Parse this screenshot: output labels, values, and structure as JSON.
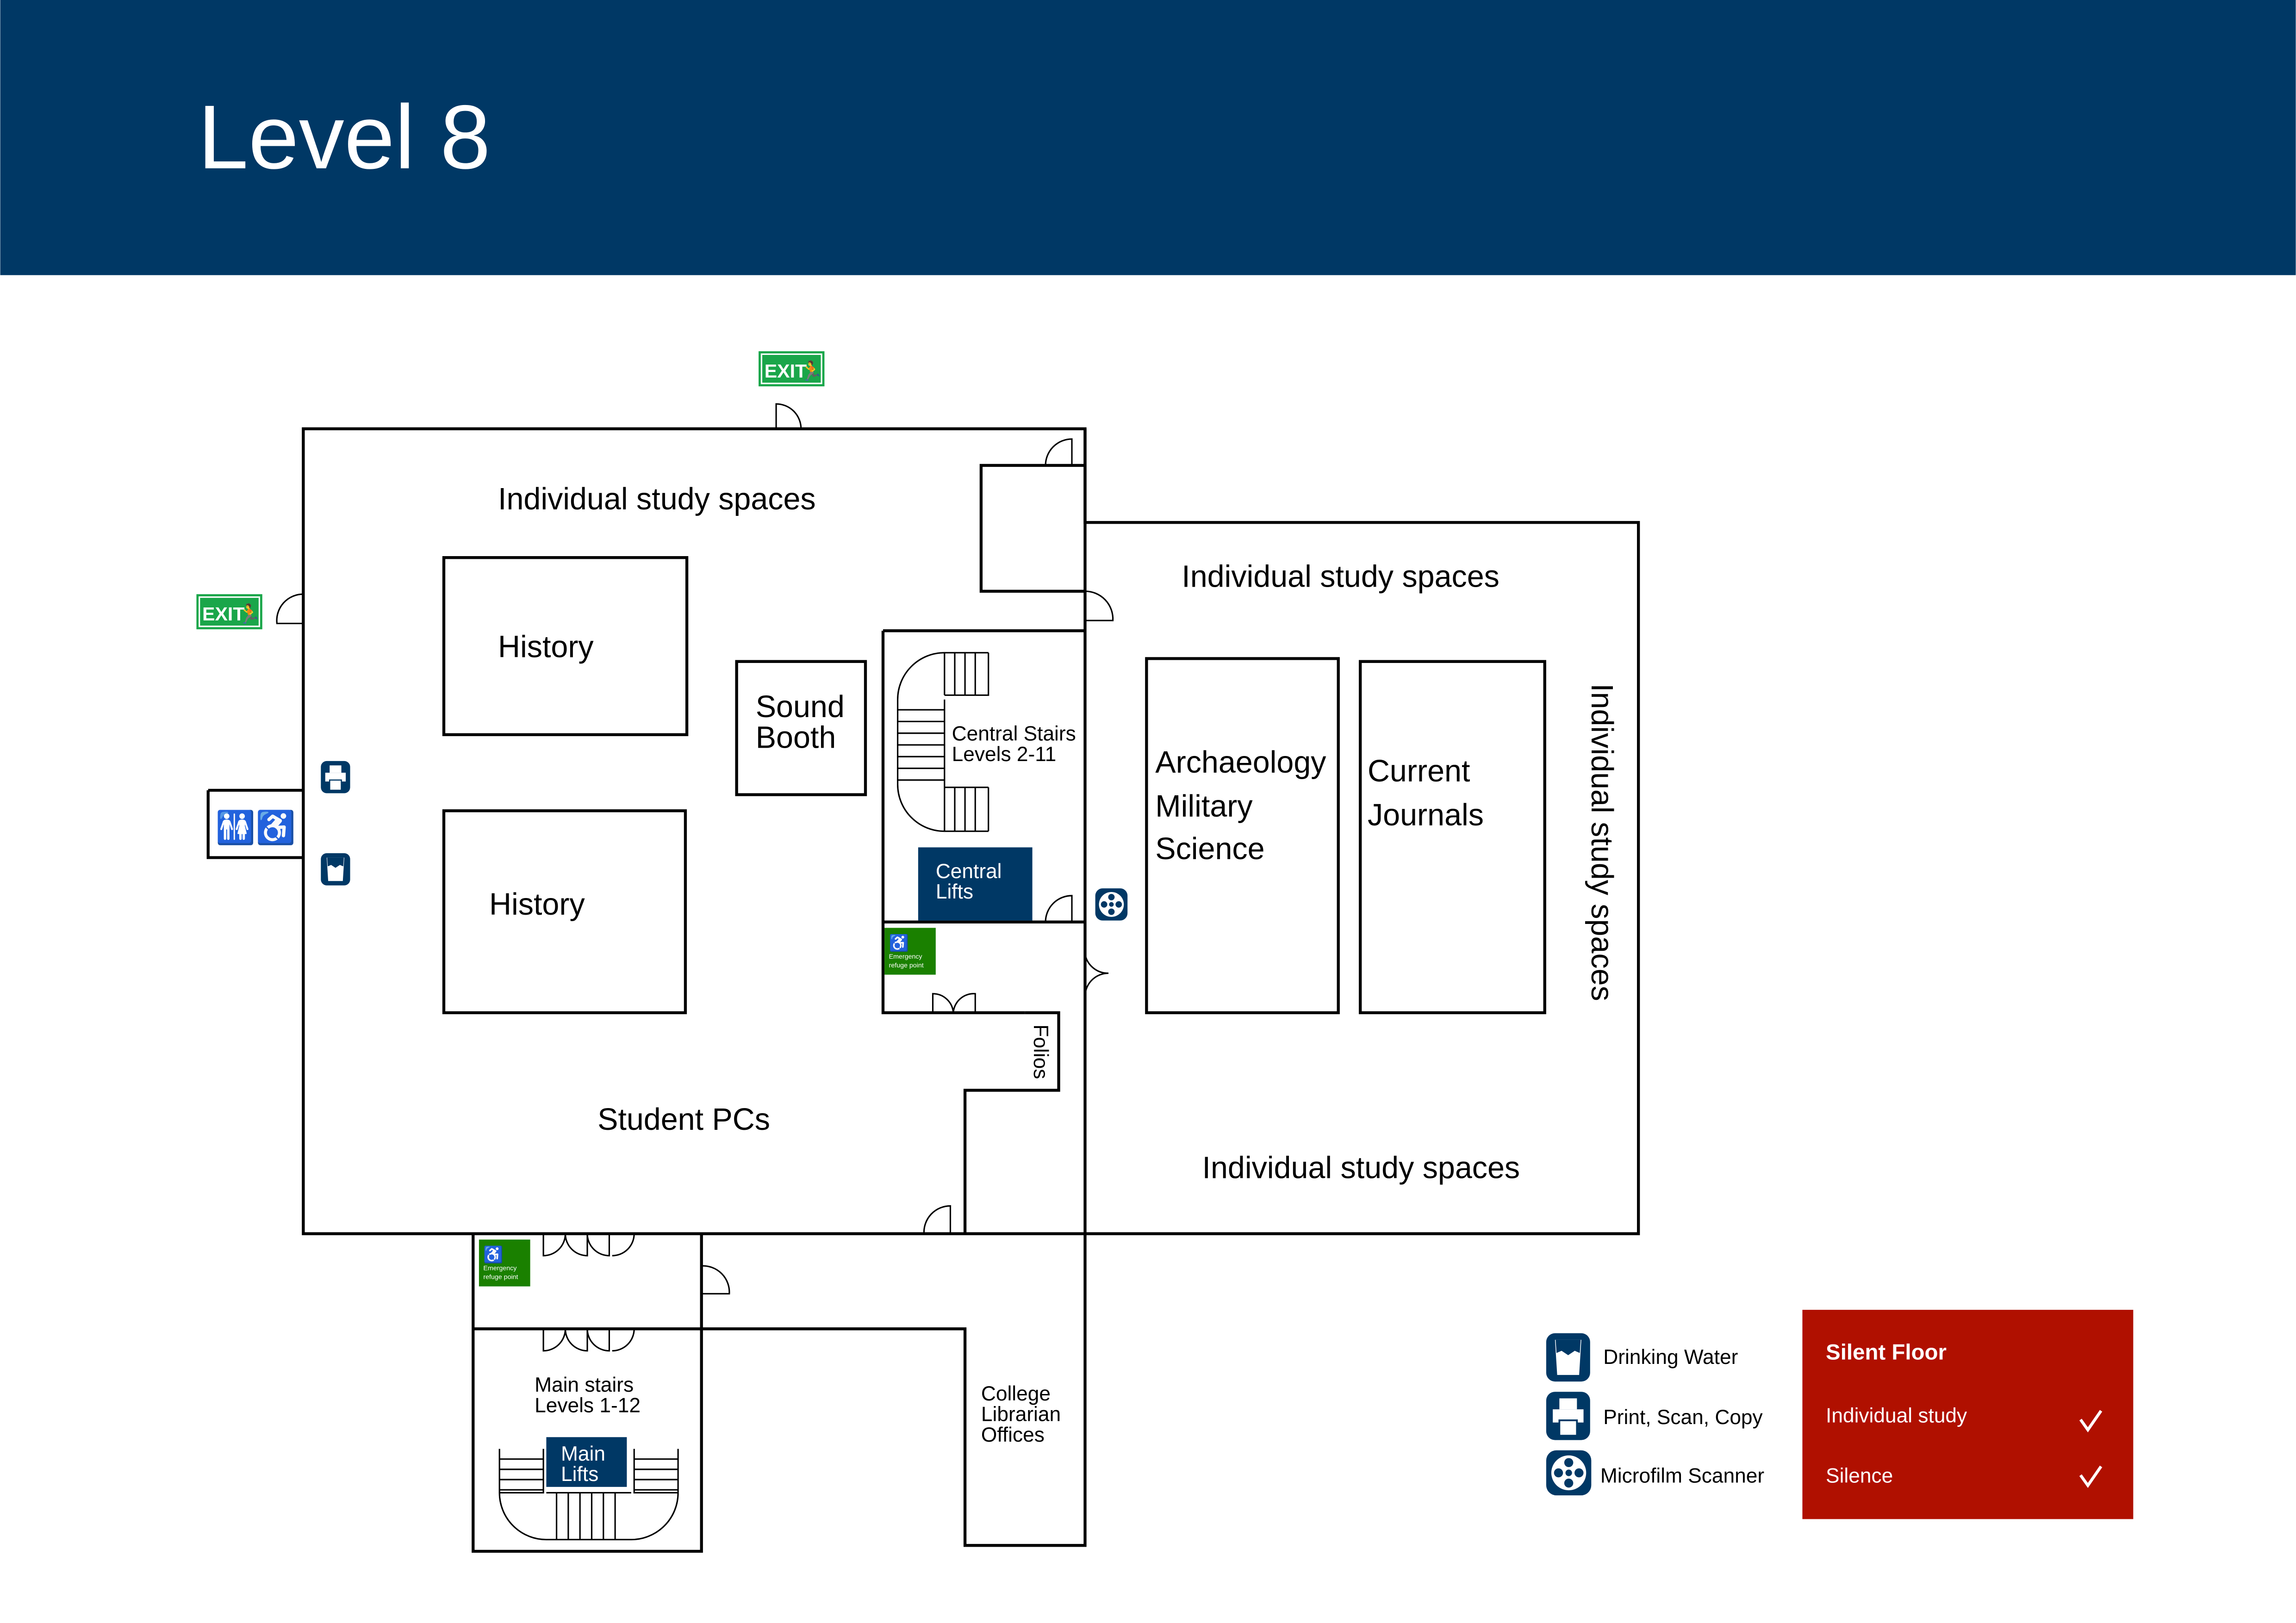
{
  "header": {
    "title": "Level 8",
    "background": "#003865"
  },
  "signs": {
    "exit": "EXIT",
    "refuge": [
      "Emergency",
      "refuge point"
    ]
  },
  "rooms": {
    "study_top_left": "Individual study spaces",
    "study_top_right": "Individual study spaces",
    "study_right_vertical": "Individual study spaces",
    "study_bottom_right": "Individual study spaces",
    "history_1": "History",
    "history_2": "History",
    "sound_booth": [
      "Sound",
      "Booth"
    ],
    "central_stairs": [
      "Central Stairs",
      "Levels 2-11"
    ],
    "central_lifts": [
      "Central",
      "Lifts"
    ],
    "archaeology": [
      "Archaeology",
      "Military",
      "Science"
    ],
    "current_journals": [
      "Current",
      "Journals"
    ],
    "folios": "Folios",
    "student_pcs": "Student PCs",
    "main_stairs": [
      "Main stairs",
      "Levels 1-12"
    ],
    "main_lifts": [
      "Main",
      "Lifts"
    ],
    "college_librarian": [
      "College",
      "Librarian",
      "Offices"
    ]
  },
  "legend": {
    "items": [
      {
        "icon": "drinking-water-icon",
        "label": "Drinking Water"
      },
      {
        "icon": "printer-icon",
        "label": "Print, Scan, Copy"
      },
      {
        "icon": "microfilm-scanner-icon",
        "label": "Microfilm Scanner"
      }
    ]
  },
  "floor_rules": {
    "title": "Silent Floor",
    "background": "#b01000",
    "rules": [
      {
        "label": "Individual study",
        "allowed": true
      },
      {
        "label": "Silence",
        "allowed": true
      }
    ]
  },
  "colors": {
    "navy": "#003865",
    "exit_green": "#1aa64a",
    "refuge_green": "#1a8000",
    "red": "#b01000"
  }
}
